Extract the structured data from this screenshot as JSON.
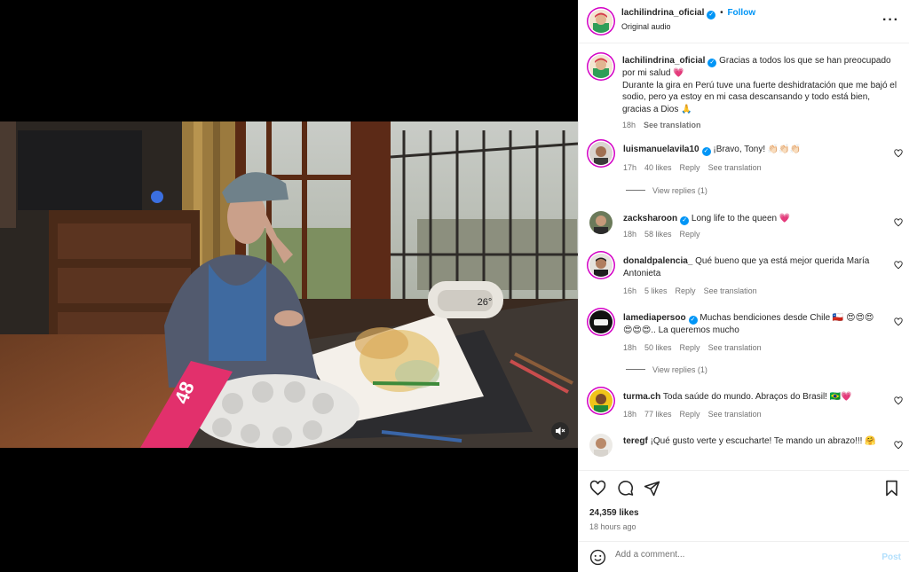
{
  "post_header": {
    "username": "lachilindrina_oficial",
    "follow_label": "Follow",
    "audio_label": "Original audio",
    "more_icon": "more-horizontal-icon"
  },
  "caption": {
    "username": "lachilindrina_oficial",
    "text": "Gracias a todos los que se han preocupado por mi salud 💗\nDurante la gira en Perú tuve una fuerte deshidratación que me bajó el sodio, pero ya estoy en mi casa descansando y todo está bien, gracias a Dios 🙏",
    "time": "18h",
    "see_translation": "See translation"
  },
  "comments": [
    {
      "username": "luismanuelavila10",
      "verified": true,
      "text": "¡Bravo, Tony! 👏🏻👏🏻👏🏻",
      "time": "17h",
      "likes": "40 likes",
      "reply": "Reply",
      "see_translation": "See translation",
      "view_replies": "View replies (1)"
    },
    {
      "username": "zacksharoon",
      "verified": true,
      "text": "Long life to the queen 💗",
      "time": "18h",
      "likes": "58 likes",
      "reply": "Reply"
    },
    {
      "username": "donaldpalencia_",
      "verified": false,
      "text": "Qué bueno que ya está mejor querida María Antonieta",
      "time": "16h",
      "likes": "5 likes",
      "reply": "Reply",
      "see_translation": "See translation"
    },
    {
      "username": "lamediapersoo",
      "verified": true,
      "text": "Muchas bendiciones desde Chile 🇨🇱 😍😍😍😍😍😍.. La queremos mucho",
      "time": "18h",
      "likes": "50 likes",
      "reply": "Reply",
      "see_translation": "See translation",
      "view_replies": "View replies (1)"
    },
    {
      "username": "turma.ch",
      "verified": false,
      "text": "Toda saúde do mundo. Abraços do Brasil! 🇧🇷💗",
      "time": "18h",
      "likes": "77 likes",
      "reply": "Reply",
      "see_translation": "See translation"
    },
    {
      "username": "teregf",
      "verified": false,
      "text": "¡Qué gusto verte y escucharte! Te mando un abrazo!!! 🤗"
    }
  ],
  "actions": {
    "likes": "24,359 likes",
    "time_ago": "18 hours ago"
  },
  "add_comment": {
    "placeholder": "Add a comment...",
    "post_label": "Post"
  },
  "video": {
    "box_text": "48",
    "clock_text": "26°"
  },
  "colors": {
    "accent": "#0095f6",
    "verified": "#0095f6",
    "text": "#262626",
    "muted": "#737373"
  }
}
